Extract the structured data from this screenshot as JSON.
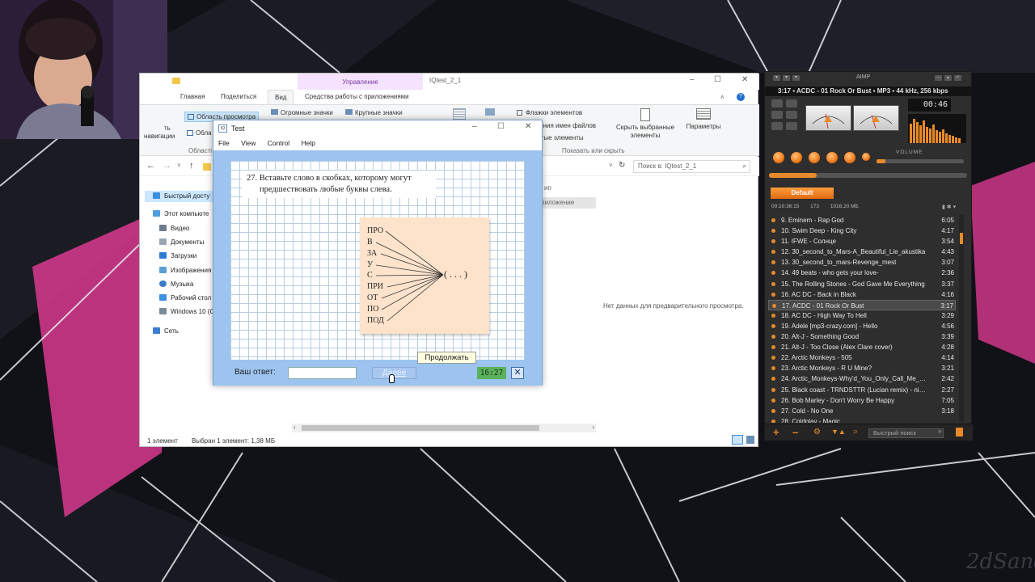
{
  "explorer": {
    "window_title": "IQtest_2_1",
    "context_tab": "Управление",
    "tabs": [
      "Главная",
      "Поделиться",
      "Вид",
      "Средства работы с приложениями"
    ],
    "ribbon": {
      "preview_pane": "Область просмотра",
      "details_pane": "Обла",
      "nav_pane_label": "ть",
      "nav_pane_label2": "навигации",
      "areas_group": "Області",
      "large_icons": "Огромные значки",
      "big_icons": "Крупные значки",
      "item_checkboxes": "Флажки элементов",
      "file_ext": "зрения имен файлов",
      "hidden_items": "ытые элементы",
      "hide_selected": "Скрыть выбранные элементы",
      "options": "Параметры",
      "show_hide_group": "Показать или скрыть"
    },
    "search_placeholder": "Поиск в: IQtest_2_1",
    "nav_items": [
      "Быстрый досту",
      "Этот компьюте",
      "Видео",
      "Документы",
      "Загрузки",
      "Изображения",
      "Музыка",
      "Рабочий стол",
      "Windows 10 (C",
      "Сеть"
    ],
    "col_type": "ип",
    "col_app": "риложение",
    "no_preview": "Нет данных для предварительного просмотра.",
    "status_count": "1 элемент",
    "status_selected": "Выбран 1 элемент: 1,38 МБ"
  },
  "test": {
    "title": "Test",
    "menu": [
      "File",
      "View",
      "Control",
      "Help"
    ],
    "question_line1": "27. Вставьте слово в скобках, которому могут",
    "question_line2": "предшествовать любые буквы слева.",
    "prefixes": [
      "ПРО",
      "В",
      "ЗА",
      "У",
      "С",
      "ПРИ",
      "ОТ",
      "ПО",
      "ПОД"
    ],
    "bracket": "( . . . )",
    "answer_label": "Ваш ответ:",
    "answer_value": "",
    "next_button": "Далее",
    "tooltip": "Продолжать",
    "timer": "16:27",
    "close_symbol": "✕"
  },
  "aimp": {
    "title": "AIMP",
    "now_playing": "3:17 ▪ ACDC - 01 Rock Or Bust ▪ MP3 ▪ 44 kHz, 256 kbps",
    "time": "00:46",
    "volume_label": "VOLUME",
    "playlist_tab": "Default",
    "playlist_duration": "00:10:36:15",
    "playlist_count": "173",
    "playlist_size": "1016,20 МБ",
    "search_placeholder": "Быстрый поиск",
    "tracks": [
      {
        "title": "9. Eminem - Rap God",
        "dur": "6:05"
      },
      {
        "title": "10. Swim Deep - King City",
        "dur": "4:17"
      },
      {
        "title": "11. IFWE - Солнце",
        "dur": "3:54"
      },
      {
        "title": "12. 30_second_to_Mars-A_Beautiful_Lie_akustika",
        "dur": "4:43"
      },
      {
        "title": "13. 30_second_to_mars-Revenge_mest",
        "dur": "3:07"
      },
      {
        "title": "14. 49 beats - who gets your love-",
        "dur": "2:36"
      },
      {
        "title": "15. The Rolling Stones - God Gave Me Everything",
        "dur": "3:37"
      },
      {
        "title": "16. AC DC - Back in Black",
        "dur": "4:16"
      },
      {
        "title": "17. ACDC - 01 Rock Or Bust",
        "dur": "3:17"
      },
      {
        "title": "18. AC DC - High Way To Hell",
        "dur": "3:29"
      },
      {
        "title": "19. Adele [mp3-crazy.com] - Hello",
        "dur": "4:56"
      },
      {
        "title": "20. Alt-J - Something Good",
        "dur": "3:39"
      },
      {
        "title": "21. Alt-J - Too Close (Alex Clare cover)",
        "dur": "4:28"
      },
      {
        "title": "22. Arctic Monkeys - 505",
        "dur": "4:14"
      },
      {
        "title": "23. Arctic Monkeys - R U Mine?",
        "dur": "3:21"
      },
      {
        "title": "24. Arctic_Monkeys-Why'd_You_Only_Call_Me_W...",
        "dur": "2:42"
      },
      {
        "title": "25. Black coast - TRNDSTTR (Lucian remix) - night...",
        "dur": "2:27"
      },
      {
        "title": "26. Bob Marley - Don't Worry Be Happy",
        "dur": "7:05"
      },
      {
        "title": "27. Cold - No One",
        "dur": "3:18"
      },
      {
        "title": "28. Coldplay - Magic",
        "dur": ""
      }
    ],
    "current_index": 8
  },
  "desktop": {
    "watermark": "2dSand"
  },
  "colors": {
    "aimp_accent": "#e98a2a",
    "test_bg": "#9cc4ef",
    "ribbon_context": "#f4e2ff"
  }
}
